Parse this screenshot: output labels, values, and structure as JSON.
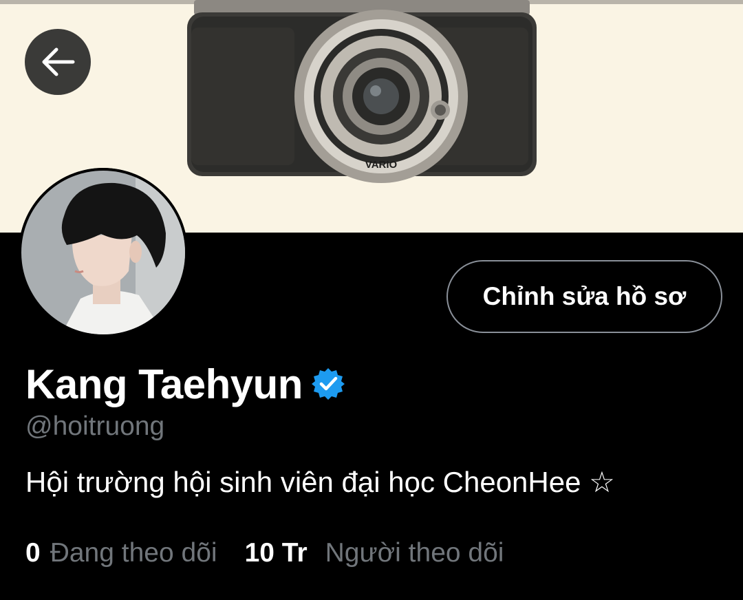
{
  "header": {
    "back_icon": "arrow-left-icon",
    "banner_image": "vintage-camera-banner",
    "banner_camera_label": "VARIO"
  },
  "profile": {
    "avatar": "profile-avatar-photo",
    "edit_button_label": "Chỉnh sửa hồ sơ",
    "display_name": "Kang Taehyun",
    "verified_icon": "verified-badge-icon",
    "handle": "@hoitruong",
    "bio": "Hội trường hội sinh viên đại học CheonHee ☆"
  },
  "stats": {
    "following_count": "0",
    "following_label": "Đang theo dõi",
    "followers_count": "10 Tr",
    "followers_label": "Người theo dõi"
  },
  "colors": {
    "background": "#000000",
    "banner": "#faf4e4",
    "verified": "#1d9bf0",
    "secondary_text": "#71767b"
  }
}
